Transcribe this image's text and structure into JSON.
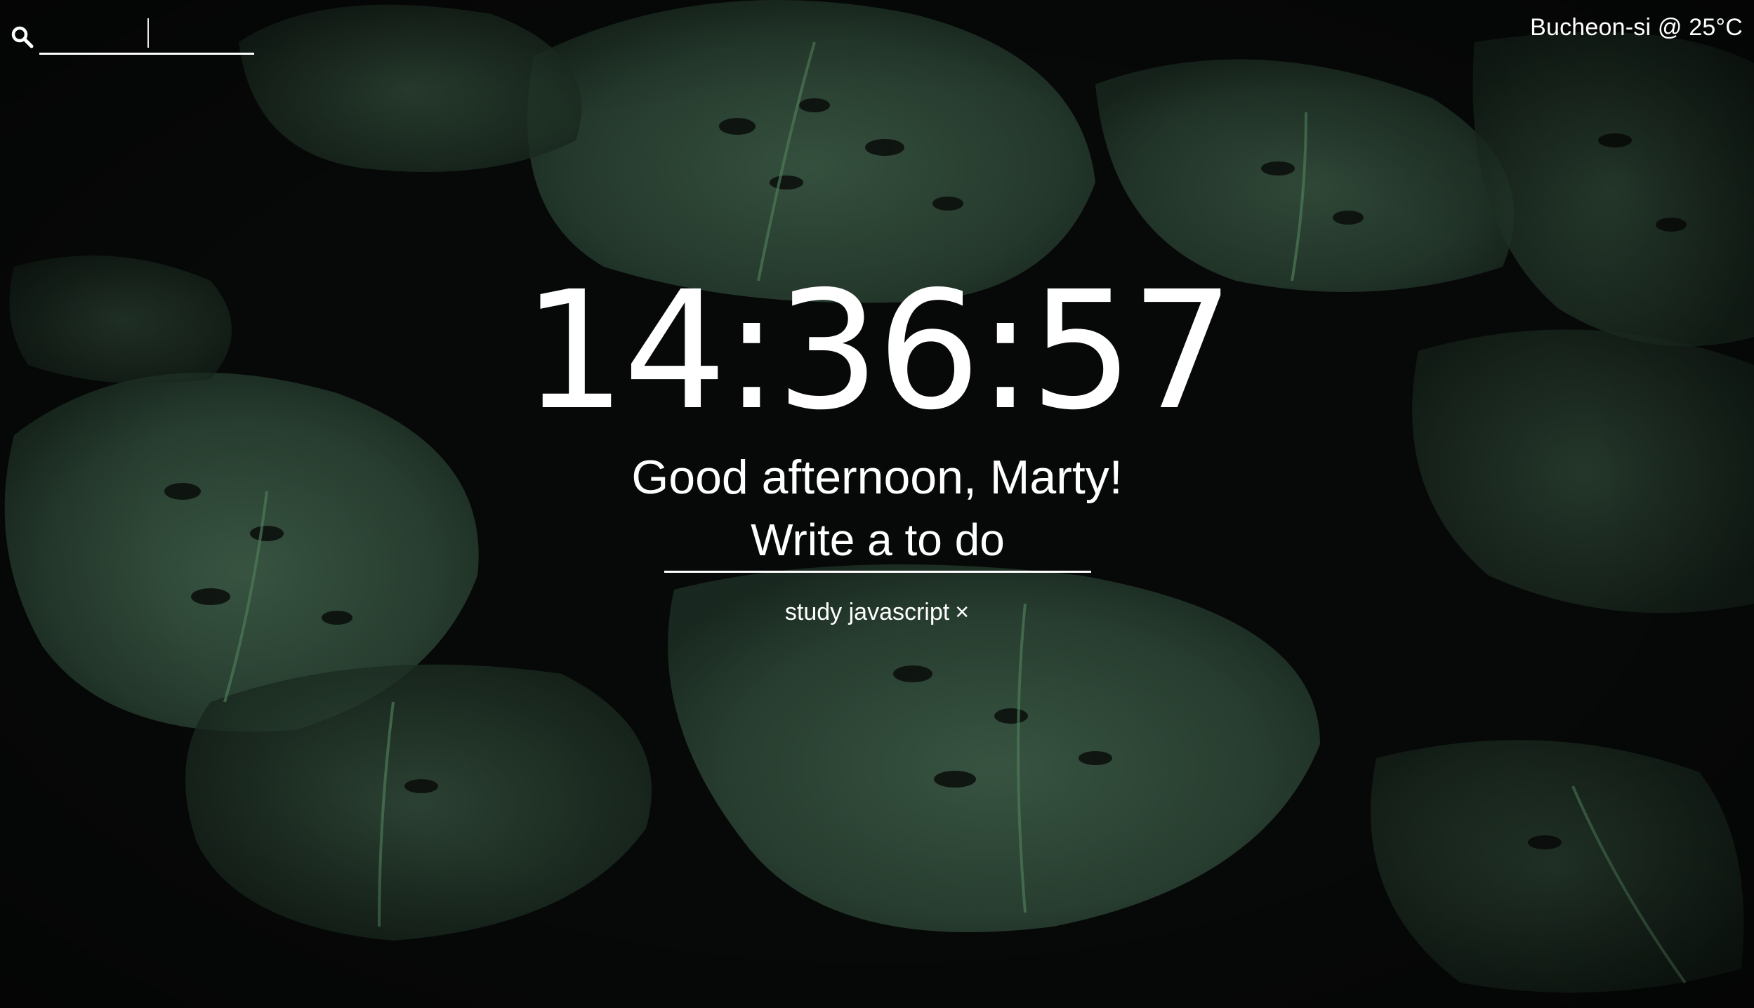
{
  "search": {
    "icon": "search-icon",
    "value": "",
    "placeholder": ""
  },
  "weather": {
    "text": "Bucheon-si @ 25°C"
  },
  "clock": {
    "time": "14:36:57"
  },
  "greeting": {
    "text": "Good afternoon, Marty!"
  },
  "todo": {
    "placeholder": "Write a to do",
    "items": [
      {
        "text": "study javascript",
        "delete_label": "×"
      }
    ]
  },
  "background": {
    "subject": "monstera leaves, dark green",
    "colors": [
      "#0a0c0b",
      "#1f3327",
      "#37543f",
      "#5a7a62"
    ]
  }
}
